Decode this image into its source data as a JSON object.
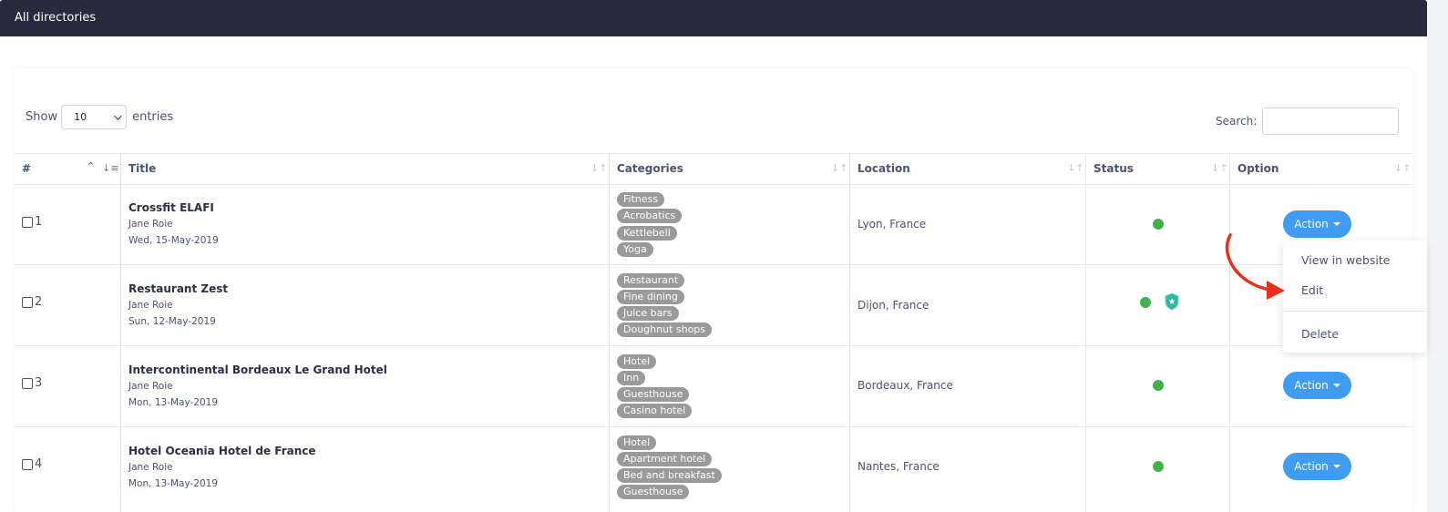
{
  "header": {
    "title": "All directories"
  },
  "controls": {
    "show_label": "Show",
    "entries_value": "10",
    "entries_label": "entries",
    "search_label": "Search:",
    "search_value": ""
  },
  "table": {
    "columns": [
      "#",
      "Title",
      "Categories",
      "Location",
      "Status",
      "Option"
    ],
    "rows": [
      {
        "num": "1",
        "title": "Crossfit ELAFI",
        "author": "Jane Roie",
        "date": "Wed, 15-May-2019",
        "categories": [
          "Fitness",
          "Acrobatics",
          "Kettlebell",
          "Yoga"
        ],
        "location": "Lyon, France",
        "status": "active",
        "featured": false
      },
      {
        "num": "2",
        "title": "Restaurant Zest",
        "author": "Jane Roie",
        "date": "Sun, 12-May-2019",
        "categories": [
          "Restaurant",
          "Fine dining",
          "Juice bars",
          "Doughnut shops"
        ],
        "location": "Dijon, France",
        "status": "active",
        "featured": true
      },
      {
        "num": "3",
        "title": "Intercontinental Bordeaux Le Grand Hotel",
        "author": "Jane Roie",
        "date": "Mon, 13-May-2019",
        "categories": [
          "Hotel",
          "Inn",
          "Guesthouse",
          "Casino hotel"
        ],
        "location": "Bordeaux, France",
        "status": "active",
        "featured": false
      },
      {
        "num": "4",
        "title": "Hotel Oceania Hotel de France",
        "author": "Jane Roie",
        "date": "Mon, 13-May-2019",
        "categories": [
          "Hotel",
          "Apartment hotel",
          "Bed and breakfast",
          "Guesthouse"
        ],
        "location": "Nantes, France",
        "status": "active",
        "featured": false
      }
    ],
    "action_label": "Action"
  },
  "dropdown": {
    "items": [
      "View in website",
      "Edit",
      "Delete"
    ]
  },
  "colors": {
    "header_bg": "#262b3e",
    "action_button": "#3f9cf0",
    "status_active": "#3fb34a",
    "tag_bg": "#9a9a9a",
    "arrow": "#e8311a",
    "shield": "#2fb8a0"
  },
  "icons": {
    "sort": "sort-icon",
    "status": "status-dot-icon",
    "featured": "shield-star-icon",
    "annotation": "red-curved-arrow-icon"
  }
}
